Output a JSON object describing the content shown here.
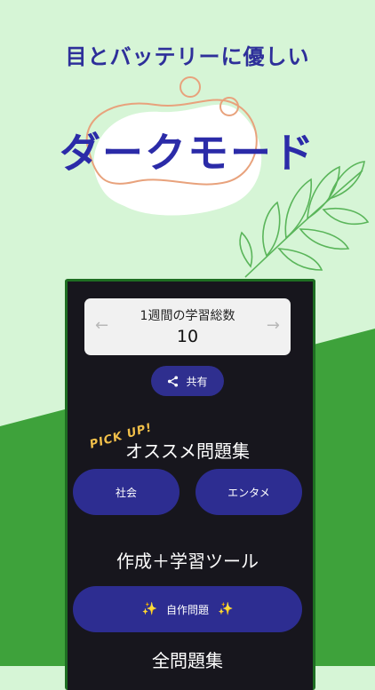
{
  "header": {
    "tagline": "目とバッテリーに優しい",
    "title": "ダークモード"
  },
  "weekly": {
    "title": "1週間の学習総数",
    "value": "10",
    "prev_arrow": "←",
    "next_arrow": "→"
  },
  "share": {
    "label": "共有",
    "icon": "share-icon"
  },
  "recommend": {
    "badge": "PICK UP!",
    "title": "オススメ問題集",
    "items": [
      {
        "label": "社会"
      },
      {
        "label": "エンタメ"
      }
    ]
  },
  "tools": {
    "title": "作成＋学習ツール",
    "button_label": "自作問題",
    "sparkle": "✨"
  },
  "all": {
    "title": "全問題集"
  },
  "colors": {
    "background_light": "#d6f5d6",
    "background_green": "#3ea23b",
    "accent_navy": "#2b2ba8",
    "phone_bg": "#17161d",
    "pill": "#2d2d91",
    "pickup_yellow": "#f2c04a"
  }
}
